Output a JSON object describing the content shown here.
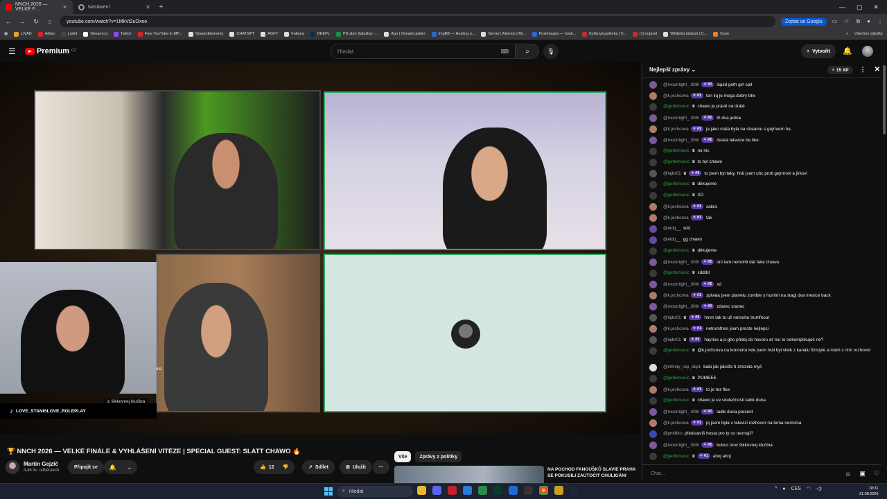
{
  "browser": {
    "tabs": [
      {
        "label": "NNCH 2026 — VELKÉ F…",
        "active": true
      },
      {
        "label": "Nastavení",
        "active": false
      }
    ],
    "url": "youtube.com/watch?v=1MkVt2uOxeo",
    "ask_google": "Zeptat se Googlu",
    "bookmarks": [
      {
        "label": "LIVAD",
        "color": "#e8a030"
      },
      {
        "label": "Adlab",
        "color": "#e02020"
      },
      {
        "label": "Lurkit",
        "color": "#444"
      },
      {
        "label": "Streamcoi",
        "color": "#fff"
      },
      {
        "label": "Twitch",
        "color": "#9146ff"
      },
      {
        "label": "Free YouTube to MP...",
        "color": "#e02020"
      },
      {
        "label": "StreamElements",
        "color": "#ddd"
      },
      {
        "label": "CHATGPT",
        "color": "#ddd"
      },
      {
        "label": "AGFY",
        "color": "#ddd"
      },
      {
        "label": "Faktura",
        "color": "#ddd"
      },
      {
        "label": "DEEPL",
        "color": "#0f2b46"
      },
      {
        "label": "PD.sbor (tabulky) -...",
        "color": "#1e8e3e"
      },
      {
        "label": "App | StreamLadder",
        "color": "#ddd"
      },
      {
        "label": "ImgBB — Hosting o...",
        "color": "#2a6ad6"
      },
      {
        "label": "Server | Aternos | Mi...",
        "color": "#ddd"
      },
      {
        "label": "Postimages — hosti...",
        "color": "#2a6ad6"
      },
      {
        "label": "Kyšková polévka | V...",
        "color": "#c03030"
      },
      {
        "label": "(1) nopixel",
        "color": "#c03030"
      },
      {
        "label": "Whitelist žádosti | C...",
        "color": "#ddd"
      },
      {
        "label": "Suno",
        "color": "#e87a30"
      }
    ],
    "all_bookmarks": "Všechny záložky"
  },
  "header": {
    "logo": "Premium",
    "logo_cc": "CZ",
    "search_placeholder": "Hledat",
    "create_label": "Vytvořit"
  },
  "video": {
    "tiktok_handle": "LOVE_STANISLOVE_ROLEPLAY",
    "caption": "ic šikkovnej klučina",
    "caption_small": "ma"
  },
  "below": {
    "title": "🏆 NNCH 2026 — VELKÉ FINÁLE & VYHLÁŠENÍ VÍTĚZE | SPECIAL GUEST: SLATT CHAWO 🔥",
    "channel": "Martin Gejzlč",
    "subs": "4,46 tis. odběratelů",
    "join": "Připojit se",
    "likes": "12",
    "share": "Sdílet",
    "save": "Uložit",
    "chips": [
      "Vše",
      "Zprávy z politiky"
    ],
    "rec_title": "NA POCHOD FANOUŠKŮ SLAVIE PRAHA SE POKUSILI ZAÚTOČIT CHULIGÁNI"
  },
  "chat": {
    "header": "Nejlepší zprávy",
    "xp": "15 XP",
    "input_placeholder": "Chat...",
    "messages": [
      {
        "user": "@moonlight_.30th",
        "badge": "#2",
        "text": "liquid goth girl spit",
        "green": false,
        "crown": false,
        "av": "#7a5a9a"
      },
      {
        "user": "@k.jochcova",
        "badge": "#1",
        "text": "ten liq je mega dobry btw",
        "green": false,
        "crown": false,
        "av": "#b07a6a"
      },
      {
        "user": "@getlixmusic",
        "badge": "",
        "text": "chawo je právě na drátě",
        "green": true,
        "crown": true,
        "av": "#3a3a3a"
      },
      {
        "user": "@moonlight_.30th",
        "badge": "#2",
        "text": "tři dva jedna",
        "green": false,
        "crown": false,
        "av": "#7a5a9a"
      },
      {
        "user": "@k.jochcova",
        "badge": "#1",
        "text": "ja jako mala byla na streamu s gejmrem ha",
        "green": false,
        "crown": false,
        "av": "#b07a6a"
      },
      {
        "user": "@moonlight_.30th",
        "badge": "#2",
        "text": "česká televize be like:",
        "green": false,
        "crown": false,
        "av": "#7a5a9a"
      },
      {
        "user": "@getlixmusic",
        "badge": "",
        "text": "no nic",
        "green": true,
        "crown": true,
        "av": "#3a3a3a"
      },
      {
        "user": "@getlixmusic",
        "badge": "",
        "text": "to byl chawo",
        "green": true,
        "crown": true,
        "av": "#3a3a3a"
      },
      {
        "user": "@lajbr01",
        "badge": "#3",
        "text": "to jsem byl taky, hrál jsem uhc proti gejmrovi a jirkovi",
        "green": false,
        "crown": true,
        "av": "#555"
      },
      {
        "user": "@getlixmusic",
        "badge": "",
        "text": "děkujeme",
        "green": true,
        "crown": true,
        "av": "#3a3a3a"
      },
      {
        "user": "@getlixmusic",
        "badge": "",
        "text": "XD",
        "green": true,
        "crown": true,
        "av": "#3a3a3a"
      },
      {
        "user": "@k.jochcova",
        "badge": "#1",
        "text": "sakra",
        "green": false,
        "crown": false,
        "av": "#b07a6a"
      },
      {
        "user": "@k.jochcova",
        "badge": "#1",
        "text": "tak",
        "green": false,
        "crown": false,
        "av": "#b07a6a"
      },
      {
        "user": "@eldq__",
        "badge": "",
        "text": "xdd",
        "green": false,
        "crown": false,
        "av": "#6a4aa0"
      },
      {
        "user": "@eldq__",
        "badge": "",
        "text": "gg chawo",
        "green": false,
        "crown": false,
        "av": "#6a4aa0"
      },
      {
        "user": "@getlixmusic",
        "badge": "",
        "text": "děkujeme",
        "green": true,
        "crown": true,
        "av": "#3a3a3a"
      },
      {
        "user": "@moonlight_.30th",
        "badge": "#2",
        "text": "oni tam nemohli dát fake chawa",
        "green": false,
        "crown": false,
        "av": "#7a5a9a"
      },
      {
        "user": "@getlixmusic",
        "badge": "",
        "text": "xdddd",
        "green": true,
        "crown": true,
        "av": "#3a3a3a"
      },
      {
        "user": "@moonlight_.30th",
        "badge": "#2",
        "text": "xd",
        "green": false,
        "crown": false,
        "av": "#7a5a9a"
      },
      {
        "user": "@k.jochcova",
        "badge": "#1",
        "text": "zpivala jsem planetu zombie s humim na stagi dva mesice back",
        "green": false,
        "crown": false,
        "av": "#b07a6a"
      },
      {
        "user": "@moonlight_.30th",
        "badge": "#2",
        "text": "zdarec sranec",
        "green": false,
        "crown": false,
        "av": "#7a5a9a"
      },
      {
        "user": "@lajbr01",
        "badge": "#3",
        "text": "hmm tak to už nemohu trumfnout",
        "green": false,
        "crown": true,
        "av": "#555"
      },
      {
        "user": "@k.jochcova",
        "badge": "#1",
        "text": "netrumfnes jsem proste nejlepci",
        "green": false,
        "crown": false,
        "av": "#b07a6a"
      },
      {
        "user": "@lajbr01",
        "badge": "#3",
        "text": "hayrise a p-gho přidej do hovoru ať mu to nekomplikuješ ne?",
        "green": false,
        "crown": true,
        "av": "#555"
      },
      {
        "user": "@getlixmusic",
        "badge": "",
        "text": "@k.jochcova na koncertu kde jsem hrál byl vitek z kanálu fizistyle a mám s ním rozhovor",
        "green": true,
        "crown": true,
        "av": "#3a3a3a",
        "tall": true
      },
      {
        "user": "@infinity_rap_dept.",
        "badge": "",
        "text": "babi jak jakože ti zmizela myš",
        "green": false,
        "crown": false,
        "av": "#ddd"
      },
      {
        "user": "@getlixmusic",
        "badge": "",
        "text": "POMEEE",
        "green": true,
        "crown": true,
        "av": "#3a3a3a"
      },
      {
        "user": "@k.jochcova",
        "badge": "#1",
        "text": "to je tez flex",
        "green": false,
        "crown": false,
        "av": "#b07a6a"
      },
      {
        "user": "@getlixmusic",
        "badge": "",
        "text": "chawo je ve skutečnosti ladik duna",
        "green": true,
        "crown": true,
        "av": "#3a3a3a"
      },
      {
        "user": "@moonlight_.30th",
        "badge": "#2",
        "text": "ladik duna present",
        "green": false,
        "crown": false,
        "av": "#7a5a9a"
      },
      {
        "user": "@k.jochcova",
        "badge": "#1",
        "text": "jq jsem byla v televizi rozhovor na tema nemcina",
        "green": false,
        "crown": false,
        "av": "#b07a6a"
      },
      {
        "user": "@pnkfbro",
        "badge": "",
        "text": "představíš hosta pro ty co neznají?",
        "green": false,
        "crown": false,
        "av": "#3a4ab0"
      },
      {
        "user": "@moonlight_.30th",
        "badge": "#2",
        "text": "kubus moc šikkovnej klučina",
        "green": false,
        "crown": false,
        "av": "#7a5a9a"
      },
      {
        "user": "@getlixmusic",
        "badge": "#1",
        "text": "ahoj ahoj",
        "green": true,
        "crown": true,
        "av": "#3a3a3a"
      }
    ]
  },
  "taskbar": {
    "search": "Hledat",
    "time": "18:31",
    "date": "31.08.2026",
    "lang": "CES"
  }
}
